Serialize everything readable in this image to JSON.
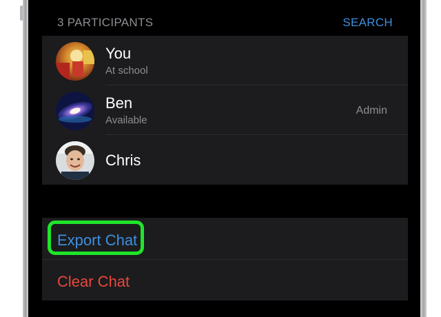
{
  "header": {
    "participants_count": "3 PARTICIPANTS",
    "search_label": "SEARCH"
  },
  "participants": [
    {
      "name": "You",
      "status": "At school",
      "role": ""
    },
    {
      "name": "Ben",
      "status": "Available",
      "role": "Admin"
    },
    {
      "name": "Chris",
      "status": "",
      "role": ""
    }
  ],
  "actions": {
    "export_chat": "Export Chat",
    "clear_chat": "Clear Chat"
  },
  "colors": {
    "accent": "#3d8fe0",
    "destructive": "#e9473c",
    "highlight": "#1fe52a",
    "background": "#000000",
    "card": "#1c1c1e"
  }
}
